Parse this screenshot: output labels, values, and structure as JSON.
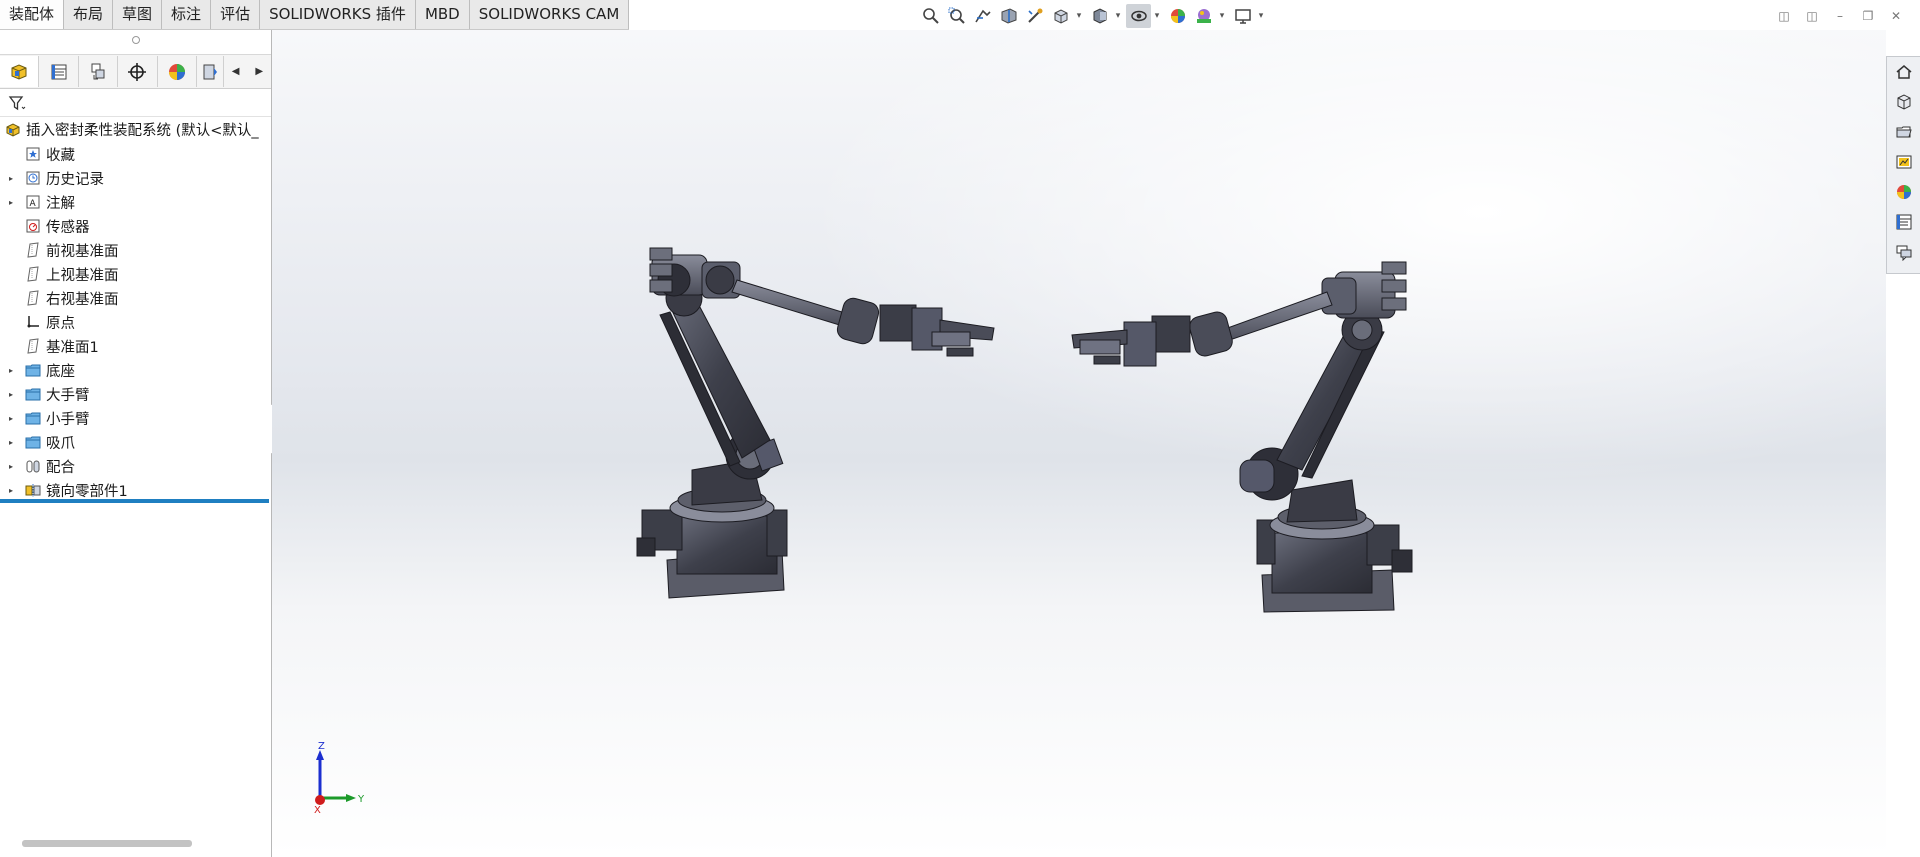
{
  "command_tabs": [
    "装配体",
    "布局",
    "草图",
    "标注",
    "评估",
    "SOLIDWORKS 插件",
    "MBD",
    "SOLIDWORKS CAM"
  ],
  "active_tab": "装配体",
  "feature_tree": {
    "root": "插入密封柔性装配系统  (默认<默认_",
    "items": [
      {
        "label": "收藏",
        "icon": "favorites-icon",
        "expandable": false
      },
      {
        "label": "历史记录",
        "icon": "history-icon",
        "expandable": true
      },
      {
        "label": "注解",
        "icon": "annotation-icon",
        "expandable": true
      },
      {
        "label": "传感器",
        "icon": "sensor-icon",
        "expandable": false
      },
      {
        "label": "前视基准面",
        "icon": "plane-icon",
        "expandable": false
      },
      {
        "label": "上视基准面",
        "icon": "plane-icon",
        "expandable": false
      },
      {
        "label": "右视基准面",
        "icon": "plane-icon",
        "expandable": false
      },
      {
        "label": "原点",
        "icon": "origin-icon",
        "expandable": false
      },
      {
        "label": "基准面1",
        "icon": "plane-icon",
        "expandable": false
      },
      {
        "label": "底座",
        "icon": "folder-icon",
        "expandable": true
      },
      {
        "label": "大手臂",
        "icon": "folder-icon",
        "expandable": true
      },
      {
        "label": "小手臂",
        "icon": "folder-icon",
        "expandable": true
      },
      {
        "label": "吸爪",
        "icon": "folder-icon",
        "expandable": true
      },
      {
        "label": "配合",
        "icon": "mates-icon",
        "expandable": true
      },
      {
        "label": "镜向零部件1",
        "icon": "mirror-component-icon",
        "expandable": true
      }
    ]
  },
  "triad": {
    "z": "Z",
    "y": "Y",
    "x": "X"
  },
  "colors": {
    "rollback_bar": "#1f7fc1",
    "robot": "#4a4c58",
    "triad_z": "#1c2fd0",
    "triad_y": "#1c9a2a",
    "triad_x": "#d01c1c"
  }
}
